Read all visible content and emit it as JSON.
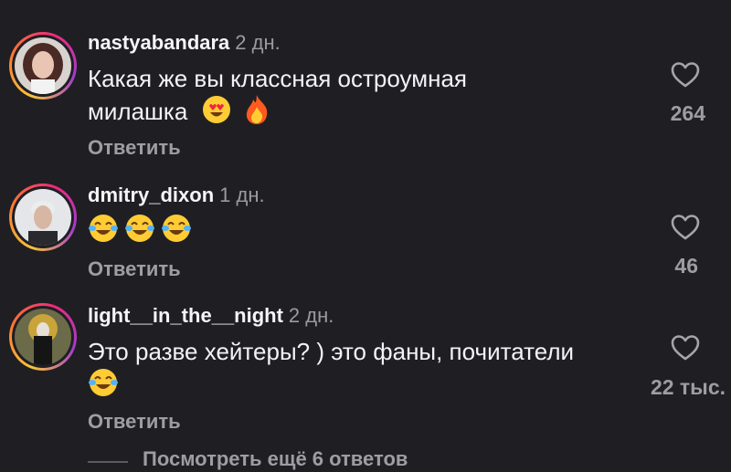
{
  "comments": [
    {
      "username": "nastyabandara",
      "time": "2 дн.",
      "text_line1": "Какая же вы классная остроумная",
      "text_line2": "милашка",
      "emojis": [
        "heart-eyes-emoji",
        "fire-emoji"
      ],
      "likes": "264",
      "reply_label": "Ответить"
    },
    {
      "username": "dmitry_dixon",
      "time": "1 дн.",
      "emojis": [
        "joy-emoji",
        "joy-emoji",
        "joy-emoji"
      ],
      "likes": "46",
      "reply_label": "Ответить"
    },
    {
      "username": "light__in_the__night",
      "time": "2 дн.",
      "text_line1": "Это разве хейтеры? ) это фаны, почитатели",
      "emojis": [
        "joy-emoji"
      ],
      "likes": "22 тыс.",
      "reply_label": "Ответить"
    }
  ],
  "view_more_replies": "Посмотреть ещё 6 ответов",
  "colors": {
    "background": "#1f1f23",
    "text": "#f3f3f5",
    "muted": "#9d9da3",
    "story_ring": [
      "#f9c23c",
      "#ee2a7b",
      "#a23bd1"
    ]
  }
}
